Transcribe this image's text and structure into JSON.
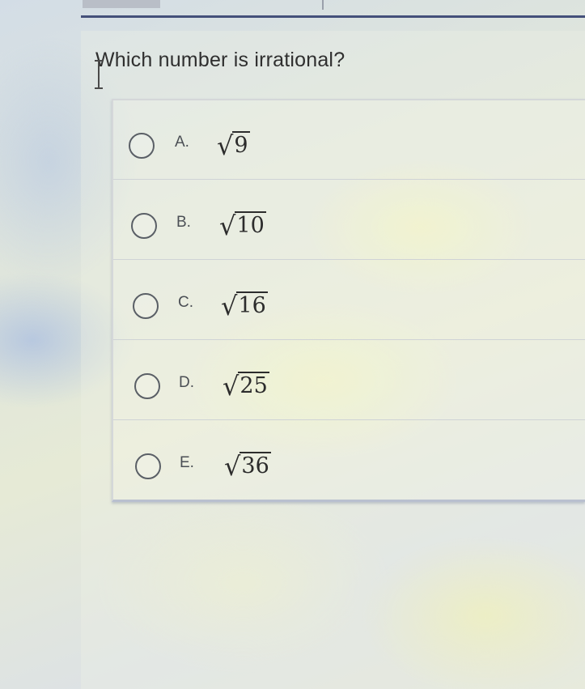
{
  "question": {
    "text": "Which number is irrational?"
  },
  "options": [
    {
      "letter": "A.",
      "radical_symbol": "√",
      "radicand": "9"
    },
    {
      "letter": "B.",
      "radical_symbol": "√",
      "radicand": "10"
    },
    {
      "letter": "C.",
      "radical_symbol": "√",
      "radicand": "16"
    },
    {
      "letter": "D.",
      "radical_symbol": "√",
      "radicand": "25"
    },
    {
      "letter": "E.",
      "radical_symbol": "√",
      "radicand": "36"
    }
  ],
  "colors": {
    "top_bar": "#44507a",
    "text": "#2f2f2f",
    "radio_border": "#5a5f66"
  }
}
